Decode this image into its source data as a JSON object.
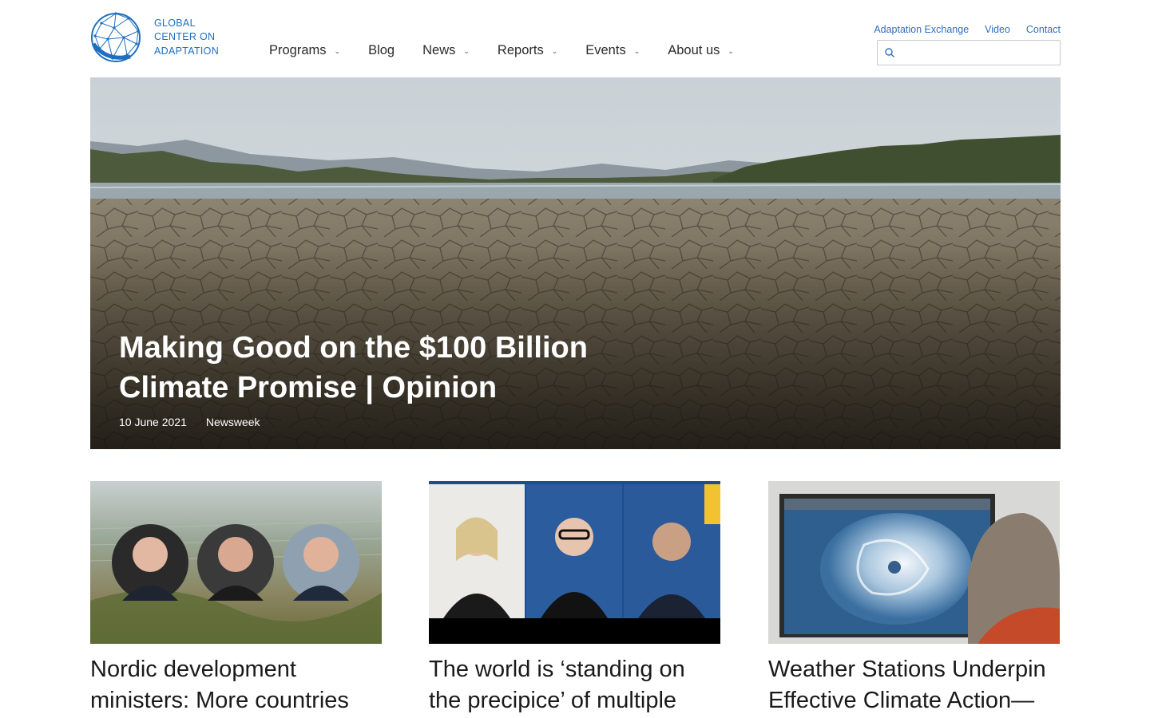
{
  "logo": {
    "line1": "GLOBAL",
    "line2": "CENTER ON",
    "line3": "ADAPTATION",
    "icon": "globe-logo-icon",
    "color": "#1f6fbf"
  },
  "nav": {
    "items": [
      {
        "label": "Programs",
        "has_dropdown": true
      },
      {
        "label": "Blog",
        "has_dropdown": false
      },
      {
        "label": "News",
        "has_dropdown": true
      },
      {
        "label": "Reports",
        "has_dropdown": true
      },
      {
        "label": "Events",
        "has_dropdown": true
      },
      {
        "label": "About us",
        "has_dropdown": true
      }
    ],
    "chevron": "⌄"
  },
  "utility": {
    "links": [
      "Adaptation Exchange",
      "Video",
      "Contact"
    ],
    "color": "#2f6fc0"
  },
  "search": {
    "placeholder": "",
    "icon": "search-icon"
  },
  "hero": {
    "title": "Making Good on the $100 Billion Climate Promise | Opinion",
    "date": "10 June 2021",
    "source": "Newsweek",
    "image": "drought-cracked-lakebed"
  },
  "cards": [
    {
      "title": "Nordic development ministers: More countries",
      "image": "ministers-portraits-over-landscape"
    },
    {
      "title": "The world is ‘standing on the precipice’ of multiple",
      "image": "video-call-panel"
    },
    {
      "title": "Weather Stations Underpin Effective Climate Action—",
      "image": "satellite-hurricane-monitor"
    }
  ]
}
